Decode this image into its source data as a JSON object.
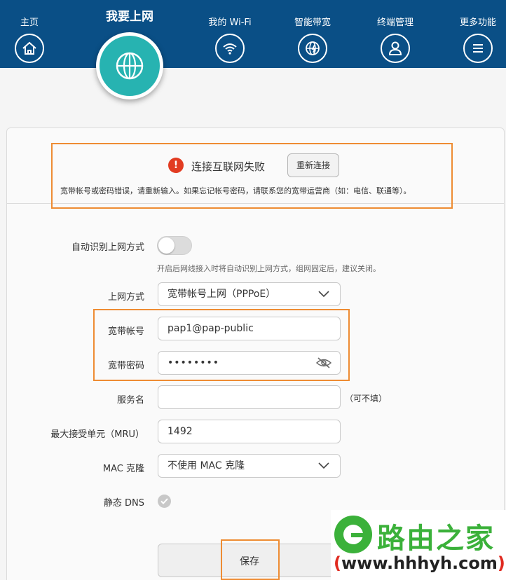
{
  "nav": {
    "items": [
      {
        "label": "主页",
        "icon": "home-icon"
      },
      {
        "label": "我要上网",
        "icon": "globe-icon",
        "active": true
      },
      {
        "label": "我的 Wi-Fi",
        "icon": "wifi-icon"
      },
      {
        "label": "智能带宽",
        "icon": "bandwidth-globe-icon"
      },
      {
        "label": "终端管理",
        "icon": "user-icon"
      },
      {
        "label": "更多功能",
        "icon": "menu-icon"
      }
    ]
  },
  "alert": {
    "icon": "error-icon",
    "title": "连接互联网失败",
    "reconnect_label": "重新连接",
    "detail": "宽带帐号或密码错误，请重新输入。如果忘记帐号密码，请联系您的宽带运营商（如：电信、联通等）。"
  },
  "form": {
    "auto_detect": {
      "label": "自动识别上网方式",
      "enabled": false,
      "hint": "开启后网线接入时将自动识别上网方式，组网固定后，建议关闭。"
    },
    "wan_mode": {
      "label": "上网方式",
      "value": "宽带帐号上网（PPPoE）"
    },
    "account": {
      "label": "宽带帐号",
      "value": "pap1@pap-public"
    },
    "password": {
      "label": "宽带密码",
      "value": "••••••••"
    },
    "service_name": {
      "label": "服务名",
      "value": "",
      "optional": "（可不填）"
    },
    "mru": {
      "label": "最大接受单元（MRU）",
      "value": "1492"
    },
    "mac_clone": {
      "label": "MAC 克隆",
      "value": "不使用 MAC 克隆"
    },
    "static_dns": {
      "label": "静态 DNS",
      "checked": true
    },
    "save_label": "保存"
  },
  "watermark": {
    "brand": "路由之家",
    "url": "www.hhhyh.com",
    "paren_open": "(",
    "paren_close": ")"
  },
  "colors": {
    "nav_bg": "#0a4f86",
    "active_circle": "#27b3b1",
    "highlight": "#ee8c33",
    "error": "#e23c22",
    "watermark_green": "#3bb13a"
  }
}
